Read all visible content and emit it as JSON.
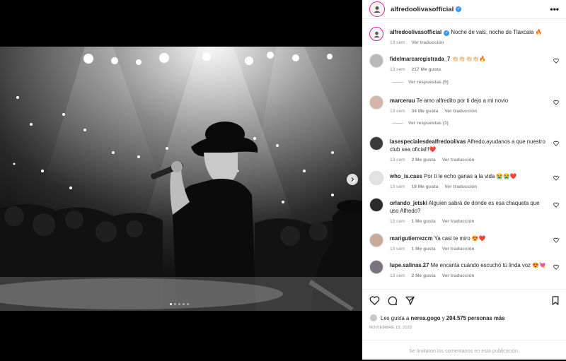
{
  "post": {
    "username": "alfredoolivasofficial",
    "caption": "Noche de vals, noche de Tlaxcala 🔥",
    "caption_time": "13 sem",
    "see_translation": "Ver traducción"
  },
  "comments": [
    {
      "user": "fidelmarcaregistrada_7",
      "text": "👏🏻👏🏻👏🏻👏🏻🔥",
      "time": "13 sem",
      "likes": "217 Me gusta",
      "translate": "",
      "replies": "Ver respuestas (5)"
    },
    {
      "user": "marceruu",
      "text": "Te amo alfredito por ti dejo a mi novio",
      "time": "13 sem",
      "likes": "34 Me gusta",
      "translate": "Ver traducción",
      "replies": "Ver respuestas (3)"
    },
    {
      "user": "lasespecialesdealfredoolivas",
      "text": "Alfredo,ayudanos a que nuestro club sea oficial!!❤️",
      "time": "13 sem",
      "likes": "2 Me gusta",
      "translate": "Ver traducción",
      "replies": ""
    },
    {
      "user": "who_is.cass",
      "text": "Por ti le echo ganas a la vida 😭😭❤️",
      "time": "13 sem",
      "likes": "19 Me gusta",
      "translate": "Ver traducción",
      "replies": ""
    },
    {
      "user": "orlando_jetski",
      "text": "Alguien sabrá de donde es esa chaqueta que uso Alfredo?",
      "time": "13 sem",
      "likes": "1 Me gusta",
      "translate": "Ver traducción",
      "replies": ""
    },
    {
      "user": "marigutierrezcm",
      "text": "Ya casi te miro 😍❤️",
      "time": "13 sem",
      "likes": "1 Me gusta",
      "translate": "Ver traducción",
      "replies": ""
    },
    {
      "user": "lupe.salinas.27",
      "text": "Me encanta cuándo escuchó tú linda voz 😍💘",
      "time": "13 sem",
      "likes": "2 Me gusta",
      "translate": "Ver traducción",
      "replies": ""
    }
  ],
  "likes": {
    "prefix": "Les gusta a",
    "user": "nerea.gogo",
    "middle": "y",
    "others": "204.575 personas más"
  },
  "date": "NOVIEMBRE 13, 2022",
  "limited": "Se limitaron los comentarios en esta publicación.",
  "colors": {
    "verified": "#3897f0",
    "heart_emoji": "#ed4956",
    "ring": "#d6249f"
  },
  "icons": [
    "heart-icon",
    "comment-icon",
    "share-icon",
    "bookmark-icon",
    "more-icon",
    "chevron-right-icon"
  ]
}
